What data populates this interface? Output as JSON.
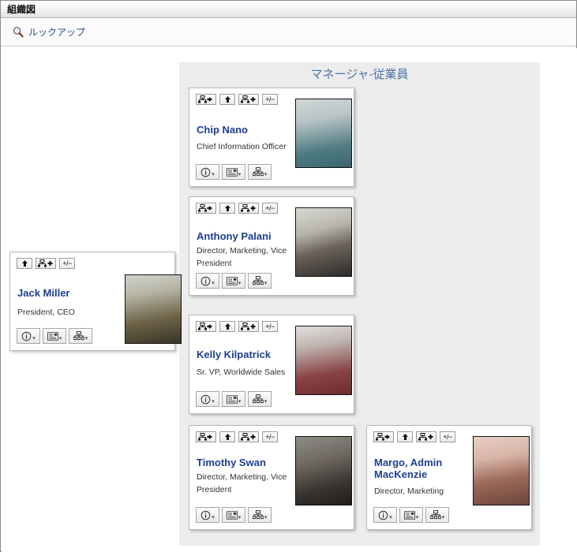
{
  "window": {
    "title": "組織図"
  },
  "toolbar": {
    "lookup_label": "ルックアップ",
    "search_icon": "magnifier-icon"
  },
  "group": {
    "title": "マネージャ-従業員"
  },
  "colors": {
    "name_link": "#1d3f8f",
    "group_title": "#4a73a8",
    "panel_bg": "#ececec",
    "card_bg": "#ffffff",
    "lookup_link": "#2a4b8d"
  },
  "card_buttons": {
    "top": [
      {
        "name": "go-to-manager-icon",
        "label": ""
      },
      {
        "name": "move-up-icon",
        "label": ""
      },
      {
        "name": "add-subordinate-icon",
        "label": ""
      },
      {
        "name": "expand-collapse-icon",
        "label": "+/−"
      }
    ],
    "bottom": [
      {
        "name": "info-icon",
        "label": ""
      },
      {
        "name": "contact-card-icon",
        "label": ""
      },
      {
        "name": "org-chart-icon",
        "label": ""
      }
    ]
  },
  "cards": [
    {
      "id": "jack-miller",
      "name": "Jack Miller",
      "title": "President, CEO",
      "photo": "jack-miller-photo",
      "has_manager_button": false
    },
    {
      "id": "chip-nano",
      "name": "Chip Nano",
      "title": "Chief Information Officer",
      "photo": "chip-nano-photo",
      "has_manager_button": true
    },
    {
      "id": "anthony-palani",
      "name": "Anthony Palani",
      "title": "Director, Marketing, Vice President",
      "photo": "anthony-palani-photo",
      "has_manager_button": true
    },
    {
      "id": "kelly-kilpatrick",
      "name": "Kelly Kilpatrick",
      "title": "Sr. VP, Worldwide Sales",
      "photo": "kelly-kilpatrick-photo",
      "has_manager_button": true
    },
    {
      "id": "timothy-swan",
      "name": "Timothy Swan",
      "title": "Director, Marketing, Vice President",
      "photo": "timothy-swan-photo",
      "has_manager_button": true
    },
    {
      "id": "margo-admin-mackenzie",
      "name": "Margo, Admin MacKenzie",
      "title": "Director, Marketing",
      "photo": "margo-mackenzie-photo",
      "has_manager_button": true
    }
  ]
}
